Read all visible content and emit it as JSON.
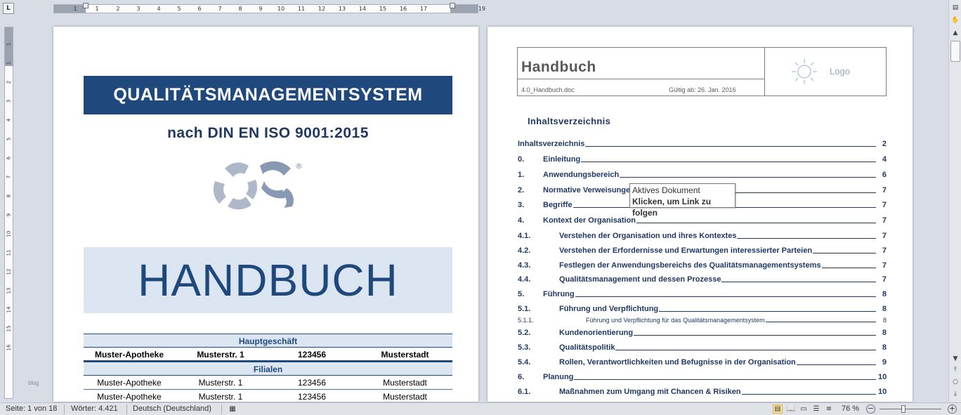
{
  "ruler": {
    "corner_label": "L",
    "h_ticks": [
      "1",
      "1",
      "2",
      "3",
      "4",
      "5",
      "6",
      "7",
      "8",
      "9",
      "10",
      "11",
      "12",
      "13",
      "14",
      "15",
      "16",
      "17",
      "19"
    ],
    "v_ticks": [
      "1",
      "1",
      "2",
      "3",
      "4",
      "5",
      "6",
      "7",
      "8",
      "9",
      "10",
      "11",
      "12",
      "13",
      "14",
      "15",
      "16"
    ]
  },
  "page1": {
    "banner": "QUALITÄTSMANAGEMENTSYSTEM",
    "subtitle": "nach DIN EN ISO 9001:2015",
    "registered_mark": "®",
    "handbuch": "HANDBUCH",
    "table": {
      "main_header": "Hauptgeschäft",
      "main_row": [
        "Muster-Apotheke",
        "Musterstr. 1",
        "123456",
        "Musterstadt"
      ],
      "branch_header": "Filialen",
      "branch_rows": [
        [
          "Muster-Apotheke",
          "Musterstr. 1",
          "123456",
          "Musterstadt"
        ],
        [
          "Muster-Apotheke",
          "Musterstr. 1",
          "123456",
          "Musterstadt"
        ]
      ]
    }
  },
  "page2": {
    "header_title": "Handbuch",
    "file_name": "4.0_Handbuch.doc",
    "valid_from": "Gültig ab: 26. Jan. 2016",
    "logo_label": "Logo",
    "toc_title": "Inhaltsverzeichnis",
    "toc": [
      {
        "num": "",
        "text": "Inhaltsverzeichnis",
        "page": "2",
        "level": 0
      },
      {
        "num": "0.",
        "text": "Einleitung",
        "page": "4",
        "level": 1
      },
      {
        "num": "1.",
        "text": "Anwendungsbereich",
        "page": "6",
        "level": 1
      },
      {
        "num": "2.",
        "text": "Normative Verweisungen",
        "page": "7",
        "level": 1
      },
      {
        "num": "3.",
        "text": "Begriffe",
        "page": "7",
        "level": 1
      },
      {
        "num": "4.",
        "text": "Kontext der Organisation",
        "page": "7",
        "level": 1
      },
      {
        "num": "4.1.",
        "text": "Verstehen der Organisation und ihres Kontextes",
        "page": "7",
        "level": 2
      },
      {
        "num": "4.2.",
        "text": "Verstehen der Erfordernisse und Erwartungen interessierter Parteien",
        "page": "7",
        "level": 2
      },
      {
        "num": "4.3.",
        "text": "Festlegen der Anwendungsbereichs des Qualitätsmanagementsystems",
        "page": "7",
        "level": 2
      },
      {
        "num": "4.4.",
        "text": "Qualitätsmanagement und dessen Prozesse",
        "page": "7",
        "level": 2
      },
      {
        "num": "5.",
        "text": "Führung",
        "page": "8",
        "level": 1
      },
      {
        "num": "5.1.",
        "text": "Führung und Verpflichtung",
        "page": "8",
        "level": 2
      },
      {
        "num": "5.1.1.",
        "text": "Führung und Verpflichtung für das Qualitätsmanagementsystem",
        "page": "8",
        "level": 3
      },
      {
        "num": "5.2.",
        "text": "Kundenorientierung",
        "page": "8",
        "level": 2
      },
      {
        "num": "5.3.",
        "text": "Qualitätspolitik",
        "page": "8",
        "level": 2
      },
      {
        "num": "5.4.",
        "text": "Rollen, Verantwortlichkeiten und Befugnisse in der Organisation",
        "page": "9",
        "level": 2
      },
      {
        "num": "6.",
        "text": "Planung",
        "page": "10",
        "level": 1
      },
      {
        "num": "6.1.",
        "text": "Maßnahmen zum Umgang mit Chancen & Risiken",
        "page": "10",
        "level": 2
      }
    ]
  },
  "tooltip": {
    "line1": "Aktives Dokument",
    "line2": "Klicken, um Link zu folgen"
  },
  "side_label": "blog",
  "statusbar": {
    "page": "Seite: 1 von 18",
    "words": "Wörter: 4.421",
    "language": "Deutsch (Deutschland)",
    "zoom": "76 %"
  },
  "colors": {
    "navy": "#1f497d",
    "light_blue": "#dce6f2",
    "toc_text": "#1f3864"
  },
  "icons": [
    "macro-record-icon",
    "print-layout-icon",
    "full-screen-reading-icon",
    "web-layout-icon",
    "outline-icon",
    "draft-icon"
  ]
}
